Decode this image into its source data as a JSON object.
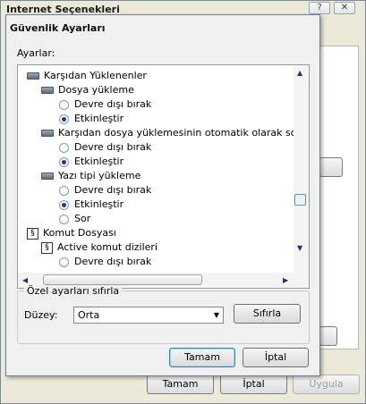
{
  "background_window": {
    "title": "Internet Seçenekleri",
    "help_button": "?",
    "close_button": "✕",
    "ok_button": "Tamam",
    "cancel_button": "İptal",
    "apply_button": "Uygula"
  },
  "dialog": {
    "title": "Güvenlik Ayarları",
    "settings_label": "Ayarlar:",
    "tree": [
      {
        "type": "category",
        "label": "Karşıdan Yüklenenler",
        "indent": 0
      },
      {
        "type": "category",
        "label": "Dosya yükleme",
        "indent": 1
      },
      {
        "type": "radio",
        "label": "Devre dışı bırak",
        "checked": false,
        "indent": 2
      },
      {
        "type": "radio",
        "label": "Etkinleştir",
        "checked": true,
        "indent": 2
      },
      {
        "type": "category",
        "label": "Karşıdan dosya yüklemesinin otomatik olarak sorulması",
        "indent": 1
      },
      {
        "type": "radio",
        "label": "Devre dışı bırak",
        "checked": false,
        "indent": 2
      },
      {
        "type": "radio",
        "label": "Etkinleştir",
        "checked": true,
        "indent": 2
      },
      {
        "type": "category",
        "label": "Yazı tipi yükleme",
        "indent": 1
      },
      {
        "type": "radio",
        "label": "Devre dışı bırak",
        "checked": false,
        "indent": 2
      },
      {
        "type": "radio",
        "label": "Etkinleştir",
        "checked": true,
        "indent": 2
      },
      {
        "type": "radio",
        "label": "Sor",
        "checked": false,
        "indent": 2
      },
      {
        "type": "script",
        "label": "Komut Dosyası",
        "indent": 0
      },
      {
        "type": "script",
        "label": "Active komut dizileri",
        "indent": 1
      },
      {
        "type": "radio",
        "label": "Devre dışı bırak",
        "checked": false,
        "indent": 2
      }
    ],
    "reset_group": {
      "title": "Özel ayarları sıfırla",
      "level_label": "Düzey:",
      "level_value": "Orta",
      "reset_button": "Sıfırla"
    },
    "ok_button": "Tamam",
    "cancel_button": "İptal"
  },
  "colors": {
    "dialog_bg": "#f0f0f0",
    "radio_dot": "#1f3d7a",
    "scroll_arrow": "#1b3966"
  }
}
